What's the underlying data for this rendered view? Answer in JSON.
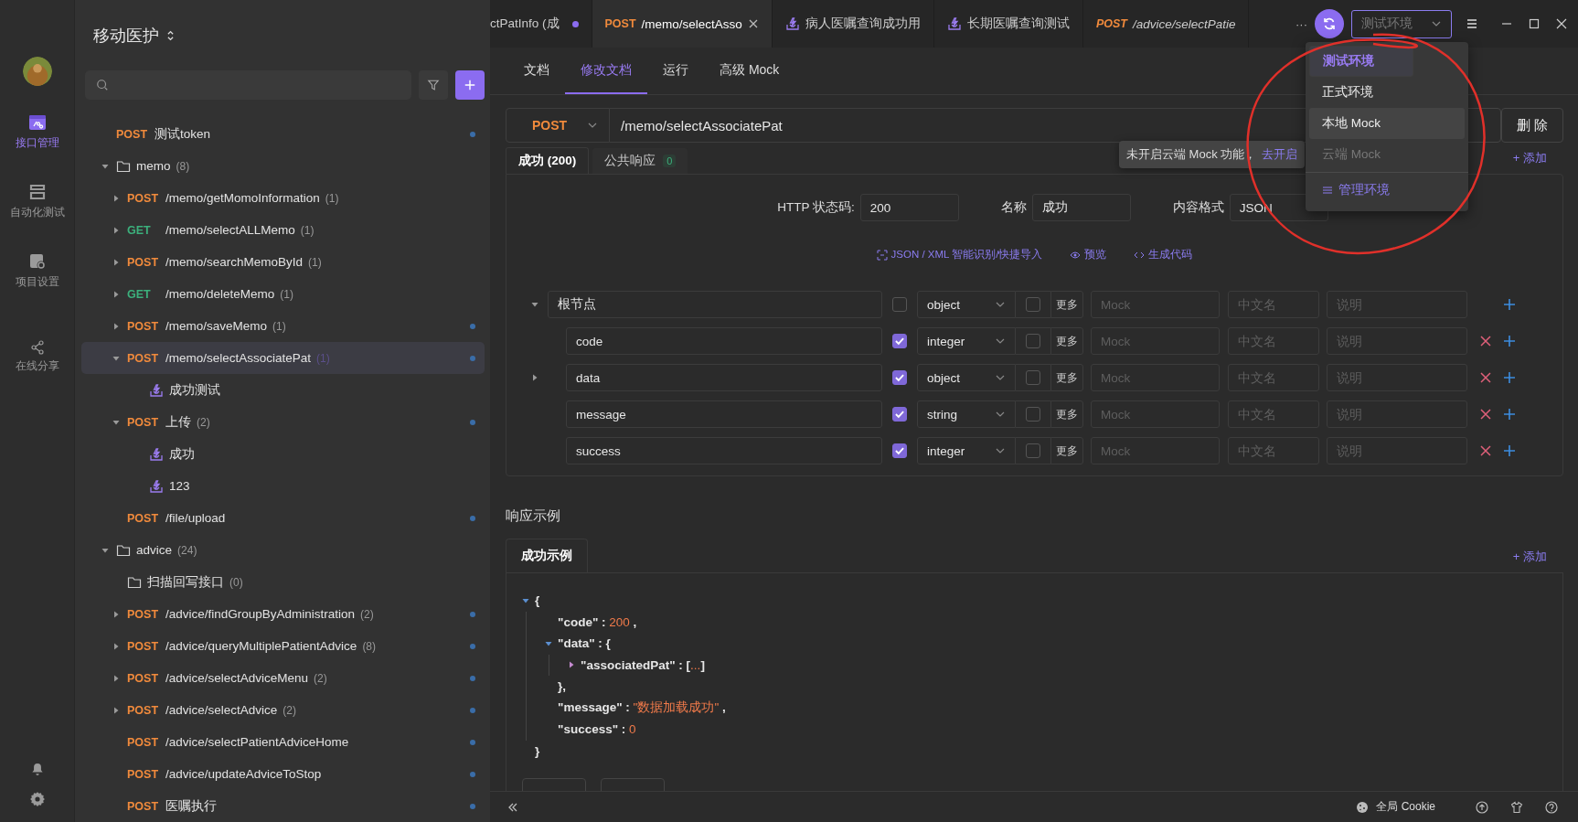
{
  "rail": {
    "items": [
      {
        "kind": "api",
        "label": "接口管理",
        "selected": true
      },
      {
        "kind": "automation",
        "label": "自动化测试",
        "selected": false
      },
      {
        "kind": "settings",
        "label": "项目设置",
        "selected": false
      },
      {
        "kind": "share",
        "label": "在线分享",
        "selected": false
      }
    ]
  },
  "sidebar": {
    "project": "移动医护",
    "tree": [
      {
        "kind": "endpoint",
        "method": "POST",
        "name": "测试token",
        "selected": false,
        "marked": true
      },
      {
        "kind": "folder",
        "name": "memo",
        "count": "(8)",
        "expanded": true,
        "selected": false,
        "marked": false,
        "children": [
          {
            "kind": "endpoint",
            "method": "POST",
            "name": "/memo/getMomoInformation",
            "count": "(1)",
            "expanded": false,
            "selected": false,
            "marked": false
          },
          {
            "kind": "endpoint",
            "method": "GET",
            "name": "/memo/selectALLMemo",
            "count": "(1)",
            "expanded": false,
            "selected": false,
            "marked": false
          },
          {
            "kind": "endpoint",
            "method": "POST",
            "name": "/memo/searchMemoById",
            "count": "(1)",
            "expanded": false,
            "selected": false,
            "marked": false
          },
          {
            "kind": "endpoint",
            "method": "GET",
            "name": "/memo/deleteMemo",
            "count": "(1)",
            "expanded": false,
            "selected": false,
            "marked": false
          },
          {
            "kind": "endpoint",
            "method": "POST",
            "name": "/memo/saveMemo",
            "count": "(1)",
            "expanded": false,
            "selected": false,
            "marked": true
          },
          {
            "kind": "endpoint",
            "method": "POST",
            "name": "/memo/selectAssociatePat",
            "count": "(1)",
            "expanded": true,
            "selected": true,
            "marked": true,
            "children": [
              {
                "kind": "case",
                "name": "成功测试",
                "selected": false,
                "marked": false
              }
            ]
          },
          {
            "kind": "endpoint",
            "method": "POST",
            "name": "上传",
            "count": "(2)",
            "expanded": true,
            "selected": false,
            "marked": true,
            "children": [
              {
                "kind": "case",
                "name": "成功",
                "selected": false,
                "marked": false
              },
              {
                "kind": "case",
                "name": "123",
                "selected": false,
                "marked": false
              }
            ]
          },
          {
            "kind": "endpoint",
            "method": "POST",
            "name": "/file/upload",
            "selected": false,
            "marked": true
          }
        ]
      },
      {
        "kind": "folder",
        "name": "advice",
        "count": "(24)",
        "expanded": true,
        "selected": false,
        "marked": false,
        "children": [
          {
            "kind": "folder",
            "name": "扫描回写接口",
            "count": "(0)",
            "selected": false,
            "marked": false
          },
          {
            "kind": "endpoint",
            "method": "POST",
            "name": "/advice/findGroupByAdministration",
            "count": "(2)",
            "expanded": false,
            "selected": false,
            "marked": true
          },
          {
            "kind": "endpoint",
            "method": "POST",
            "name": "/advice/queryMultiplePatientAdvice",
            "count": "(8)",
            "expanded": false,
            "selected": false,
            "marked": true
          },
          {
            "kind": "endpoint",
            "method": "POST",
            "name": "/advice/selectAdviceMenu",
            "count": "(2)",
            "expanded": false,
            "selected": false,
            "marked": true
          },
          {
            "kind": "endpoint",
            "method": "POST",
            "name": "/advice/selectAdvice",
            "count": "(2)",
            "expanded": false,
            "selected": false,
            "marked": true
          },
          {
            "kind": "endpoint",
            "method": "POST",
            "name": "/advice/selectPatientAdviceHome",
            "selected": false,
            "marked": true
          },
          {
            "kind": "endpoint",
            "method": "POST",
            "name": "/advice/updateAdviceToStop",
            "selected": false,
            "marked": true
          },
          {
            "kind": "endpoint",
            "method": "POST",
            "name": "医嘱执行",
            "selected": false,
            "marked": true
          }
        ]
      }
    ]
  },
  "tabs": [
    {
      "kind": "plain",
      "title": "ctPatInfo (成",
      "selected": false,
      "dirty": true,
      "preview": false
    },
    {
      "kind": "endpoint",
      "method": "POST",
      "title": "/memo/selectAsso",
      "selected": true,
      "dirty": false,
      "preview": false
    },
    {
      "kind": "case",
      "title": "病人医嘱查询成功用",
      "selected": false,
      "dirty": false,
      "preview": false
    },
    {
      "kind": "case",
      "title": "长期医嘱查询测试",
      "selected": false,
      "dirty": false,
      "preview": false
    },
    {
      "kind": "endpoint",
      "method": "POST",
      "title": "/advice/selectPatie",
      "selected": false,
      "dirty": false,
      "preview": true
    }
  ],
  "more_tabs": "···",
  "environment": {
    "value": "测试环境",
    "menu": [
      {
        "label": "测试环境",
        "selected": true,
        "hovered": false,
        "disabled": false
      },
      {
        "label": "正式环境",
        "selected": false,
        "hovered": false,
        "disabled": false
      },
      {
        "label": "本地 Mock",
        "selected": false,
        "hovered": true,
        "disabled": false
      },
      {
        "label": "云端 Mock",
        "selected": false,
        "hovered": false,
        "disabled": true
      }
    ],
    "manage": "管理环境"
  },
  "tooltip": {
    "text": "未开启云端 Mock 功能，",
    "link": "去开启"
  },
  "subtabs": [
    {
      "label": "文档",
      "selected": false
    },
    {
      "label": "修改文档",
      "selected": true
    },
    {
      "label": "运行",
      "selected": false
    },
    {
      "label": "高级 Mock",
      "selected": false
    }
  ],
  "request": {
    "method": "POST",
    "path": "/memo/selectAssociatePat",
    "buttons": [
      "删 除"
    ]
  },
  "responses": {
    "tabs": [
      {
        "label": "成功 (200)",
        "selected": true
      },
      {
        "label": "公共响应",
        "count": "0",
        "selected": false
      }
    ],
    "add": "+ 添加",
    "status_label": "HTTP 状态码:",
    "status": "200",
    "name_label": "名称",
    "name": "成功",
    "format_label": "内容格式",
    "format": "JSON",
    "tools": [
      {
        "kind": "import",
        "label": "JSON / XML 智能识别/快捷导入"
      },
      {
        "kind": "preview",
        "label": "预览"
      },
      {
        "kind": "code",
        "label": "生成代码"
      }
    ],
    "fields": [
      {
        "kind": "root",
        "name": "根节点",
        "required": false,
        "type": "object",
        "nullable": false,
        "expanded": true,
        "more": "更多",
        "mock_placeholder": "Mock",
        "cn_placeholder": "中文名",
        "desc_placeholder": "说明"
      },
      {
        "kind": "field",
        "name": "code",
        "required": true,
        "type": "integer",
        "nullable": false,
        "more": "更多",
        "mock_placeholder": "Mock",
        "cn_placeholder": "中文名",
        "desc_placeholder": "说明"
      },
      {
        "kind": "field",
        "name": "data",
        "required": true,
        "type": "object",
        "nullable": false,
        "expanded": false,
        "more": "更多",
        "mock_placeholder": "Mock",
        "cn_placeholder": "中文名",
        "desc_placeholder": "说明"
      },
      {
        "kind": "field",
        "name": "message",
        "required": true,
        "type": "string",
        "nullable": false,
        "more": "更多",
        "mock_placeholder": "Mock",
        "cn_placeholder": "中文名",
        "desc_placeholder": "说明"
      },
      {
        "kind": "field",
        "name": "success",
        "required": true,
        "type": "integer",
        "nullable": false,
        "more": "更多",
        "mock_placeholder": "Mock",
        "cn_placeholder": "中文名",
        "desc_placeholder": "说明"
      }
    ]
  },
  "examples": {
    "heading": "响应示例",
    "tabs": [
      {
        "label": "成功示例",
        "selected": true
      }
    ],
    "add": "+ 添加",
    "code": [
      {
        "parts": [
          {
            "kind": "punct",
            "text": "{"
          }
        ],
        "expanded": true,
        "close": [
          {
            "kind": "punct",
            "text": "}"
          }
        ],
        "children": [
          {
            "parts": [
              {
                "kind": "key",
                "text": "\"code\""
              },
              {
                "kind": "punct",
                "text": " : "
              },
              {
                "kind": "number",
                "text": "200"
              },
              {
                "kind": "punct",
                "text": " ,"
              }
            ]
          },
          {
            "parts": [
              {
                "kind": "key",
                "text": "\"data\""
              },
              {
                "kind": "punct",
                "text": " : "
              },
              {
                "kind": "punct",
                "text": "{"
              }
            ],
            "expanded": true,
            "close": [
              {
                "kind": "punct",
                "text": "},"
              }
            ],
            "children": [
              {
                "parts": [
                  {
                    "kind": "key",
                    "text": "\"associatedPat\""
                  },
                  {
                    "kind": "punct",
                    "text": " : "
                  },
                  {
                    "kind": "punct",
                    "text": "["
                  },
                  {
                    "kind": "string",
                    "text": "..."
                  },
                  {
                    "kind": "punct",
                    "text": "]"
                  }
                ],
                "expanded": false
              }
            ]
          },
          {
            "parts": [
              {
                "kind": "key",
                "text": "\"message\""
              },
              {
                "kind": "punct",
                "text": " : "
              },
              {
                "kind": "string",
                "text": "\"数据加载成功\""
              },
              {
                "kind": "punct",
                "text": " ,"
              }
            ]
          },
          {
            "parts": [
              {
                "kind": "key",
                "text": "\"success\""
              },
              {
                "kind": "punct",
                "text": " : "
              },
              {
                "kind": "number",
                "text": "0"
              }
            ]
          }
        ]
      }
    ]
  },
  "status_bar": {
    "cookie": "全局 Cookie"
  }
}
